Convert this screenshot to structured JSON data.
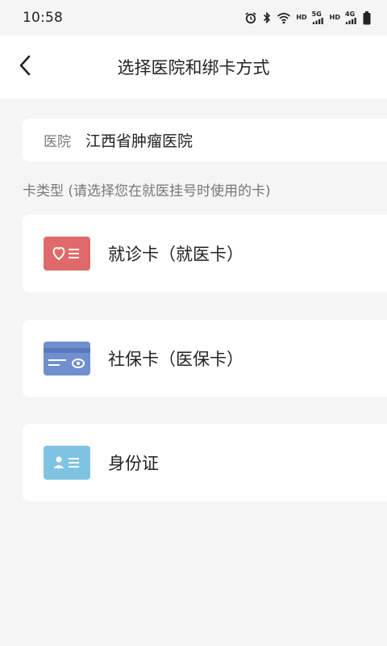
{
  "status_bar": {
    "time": "10:58",
    "icons": [
      "alarm-icon",
      "bluetooth-icon",
      "wifi-icon",
      "signal-icon",
      "battery-icon"
    ],
    "hd1": "HD",
    "net1": "5G",
    "hd2": "HD",
    "net2": "4G"
  },
  "header": {
    "title": "选择医院和绑卡方式",
    "back_icon": "chevron-left-icon"
  },
  "hospital": {
    "label": "医院",
    "value": "江西省肿瘤医院"
  },
  "card_type_hint": "卡类型 (请选择您在就医挂号时使用的卡)",
  "card_options": [
    {
      "label": "就诊卡（就医卡）",
      "icon": "medical-card-icon",
      "color": "#e06a6a"
    },
    {
      "label": "社保卡（医保卡）",
      "icon": "social-security-card-icon",
      "color": "#6f8fcf"
    },
    {
      "label": "身份证",
      "icon": "id-card-icon",
      "color": "#7ec4e2"
    }
  ],
  "colors": {
    "background": "#f5f5f5",
    "card_background": "#ffffff"
  }
}
